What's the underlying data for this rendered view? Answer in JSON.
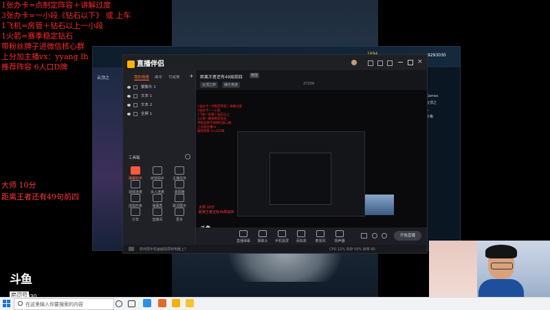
{
  "overlay": {
    "lines": [
      "1张办卡=点制定阵容＋讲解过度",
      "3张办卡=一小段《钻石以下》 或 上车",
      "1飞机=房管＋钻石以上一小段",
      "1火箭=赛季稳定钻石",
      "带粉丝牌子进微信核心群",
      "上分加主播vx：yyang Ih",
      "推荐阵容 6人口D牌"
    ],
    "rank": "大师 10分",
    "distance": "距离王者还有49句前四"
  },
  "douyu": {
    "logo": "斗鱼",
    "sub": "房间号",
    "room_id": "9293030"
  },
  "game": {
    "coin": "1694",
    "room_number": "9293030",
    "left_label": "云顶之",
    "right_menu": [
      "Games",
      "云顶之",
      "...",
      "价格"
    ]
  },
  "app": {
    "name": "直播伴侣",
    "tabs": [
      "我的场景",
      "画中",
      "可成美"
    ],
    "sources": [
      "摄像头 1",
      "文本 1",
      "文本 2",
      "全屏 1"
    ],
    "tools_title": "工具箱",
    "tools": [
      {
        "label": "弹幕助手",
        "hot": true
      },
      {
        "label": "房管助手",
        "hot": false
      },
      {
        "label": "主播任务",
        "hot": false
      },
      {
        "label": "视频连麦",
        "hot": false
      },
      {
        "label": "多人连麦",
        "hot": false
      },
      {
        "label": "录屏器",
        "hot": false
      },
      {
        "label": "虚拟形象",
        "hot": false
      },
      {
        "label": "弹幕秀",
        "hot": false
      },
      {
        "label": "歌词展示",
        "hot": false
      },
      {
        "label": "分享",
        "hot": false
      },
      {
        "label": "直播间",
        "hot": false
      },
      {
        "label": "更多",
        "hot": false
      }
    ],
    "stream_title": "距离王者还有49局前四",
    "edit_label": "修改",
    "category_1": "云顶之弈",
    "category_2": "娱乐竞技",
    "hot_count": "27239",
    "bottom_tools": [
      "直播弹幕",
      "摄像头",
      "手机投屏",
      "添加源",
      "麦克风",
      "扬声器"
    ],
    "start_live": "开始直播",
    "status_message": "如何把手机画面投屏到电脑上？",
    "status_right": "CPU 12%  内存 50%  帧率 60"
  },
  "preview": {
    "red_text": "1张办卡=点制定阵容＋讲解过度\n3张办卡=一小段\n1飞机=房管＋钻石以上\n1火箭=赛季稳定钻石\n带粉丝牌子进微信核心群\n上分加主播vx\n推荐阵容 6人口D牌",
    "rank": "大师 10分\n距离王者还有49局前四"
  },
  "taskbar": {
    "search_placeholder": "在这里输入你要搜索的内容"
  }
}
